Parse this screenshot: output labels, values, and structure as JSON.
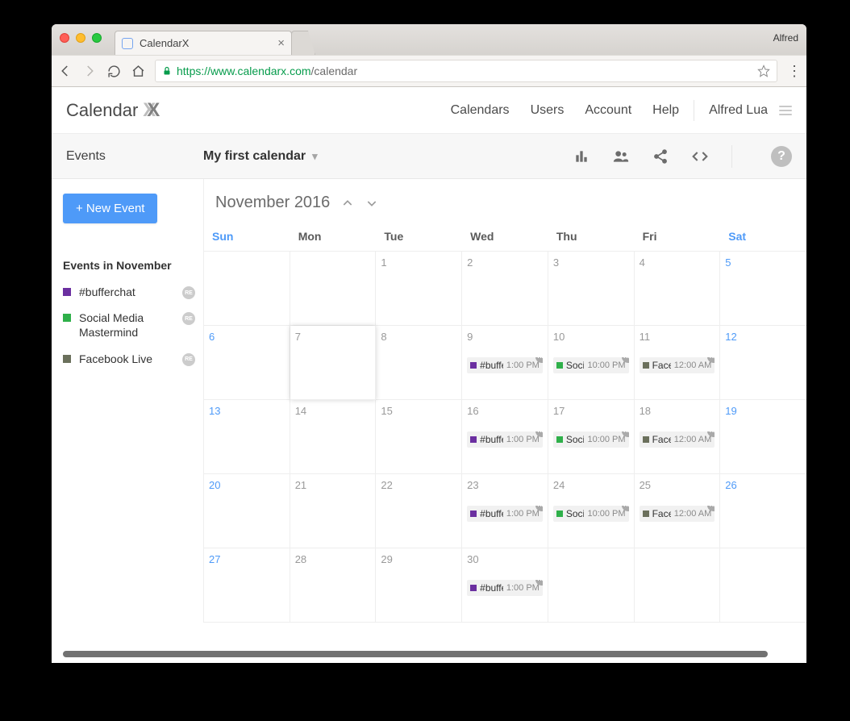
{
  "browser": {
    "profile_name": "Alfred",
    "tab_title": "CalendarX",
    "url_scheme": "https://",
    "url_host": "www.calendarx.com",
    "url_path": "/calendar"
  },
  "app": {
    "logo_text": "Calendar",
    "nav": {
      "calendars": "Calendars",
      "users": "Users",
      "account": "Account",
      "help": "Help"
    },
    "user_name": "Alfred Lua"
  },
  "subheader": {
    "left": "Events",
    "calendar_selector": "My first calendar"
  },
  "sidebar": {
    "new_event": "+ New Event",
    "heading": "Events in November",
    "items": [
      {
        "id": "bufferchat",
        "label": "#bufferchat",
        "color": "#6b2fa0",
        "badge": "RE"
      },
      {
        "id": "social",
        "label": "Social Media Mastermind",
        "color": "#2fb04a",
        "badge": "RE"
      },
      {
        "id": "facebook",
        "label": "Facebook Live",
        "color": "#6b705c",
        "badge": "RE"
      }
    ]
  },
  "calendar": {
    "title": "November 2016",
    "day_headers": [
      "Sun",
      "Mon",
      "Tue",
      "Wed",
      "Thu",
      "Fri",
      "Sat"
    ],
    "cells": [
      {
        "num": "",
        "we": true,
        "events": []
      },
      {
        "num": "",
        "events": []
      },
      {
        "num": "1",
        "events": []
      },
      {
        "num": "2",
        "events": []
      },
      {
        "num": "3",
        "events": []
      },
      {
        "num": "4",
        "events": []
      },
      {
        "num": "5",
        "we": true,
        "events": []
      },
      {
        "num": "6",
        "we": true,
        "events": []
      },
      {
        "num": "7",
        "today": true,
        "events": []
      },
      {
        "num": "8",
        "events": []
      },
      {
        "num": "9",
        "events": [
          {
            "ev": "bufferchat",
            "title": "#buffe",
            "time": "1:00 PM"
          }
        ]
      },
      {
        "num": "10",
        "events": [
          {
            "ev": "social",
            "title": "Socia",
            "time": "10:00 PM"
          }
        ]
      },
      {
        "num": "11",
        "events": [
          {
            "ev": "facebook",
            "title": "Face",
            "time": "12:00 AM"
          }
        ]
      },
      {
        "num": "12",
        "we": true,
        "events": []
      },
      {
        "num": "13",
        "we": true,
        "events": []
      },
      {
        "num": "14",
        "events": []
      },
      {
        "num": "15",
        "events": []
      },
      {
        "num": "16",
        "events": [
          {
            "ev": "bufferchat",
            "title": "#buffe",
            "time": "1:00 PM"
          }
        ]
      },
      {
        "num": "17",
        "events": [
          {
            "ev": "social",
            "title": "Socia",
            "time": "10:00 PM"
          }
        ]
      },
      {
        "num": "18",
        "events": [
          {
            "ev": "facebook",
            "title": "Face",
            "time": "12:00 AM"
          }
        ]
      },
      {
        "num": "19",
        "we": true,
        "events": []
      },
      {
        "num": "20",
        "we": true,
        "events": []
      },
      {
        "num": "21",
        "events": []
      },
      {
        "num": "22",
        "events": []
      },
      {
        "num": "23",
        "events": [
          {
            "ev": "bufferchat",
            "title": "#buffe",
            "time": "1:00 PM"
          }
        ]
      },
      {
        "num": "24",
        "events": [
          {
            "ev": "social",
            "title": "Socia",
            "time": "10:00 PM"
          }
        ]
      },
      {
        "num": "25",
        "events": [
          {
            "ev": "facebook",
            "title": "Face",
            "time": "12:00 AM"
          }
        ]
      },
      {
        "num": "26",
        "we": true,
        "events": []
      },
      {
        "num": "27",
        "we": true,
        "events": []
      },
      {
        "num": "28",
        "events": []
      },
      {
        "num": "29",
        "events": []
      },
      {
        "num": "30",
        "events": [
          {
            "ev": "bufferchat",
            "title": "#buffe",
            "time": "1:00 PM"
          }
        ]
      },
      {
        "num": "",
        "events": []
      },
      {
        "num": "",
        "events": []
      },
      {
        "num": "",
        "we": true,
        "events": []
      }
    ]
  },
  "colors": {
    "bufferchat": "#6b2fa0",
    "social": "#2fb04a",
    "facebook": "#6b705c"
  },
  "re_badge": "RE"
}
